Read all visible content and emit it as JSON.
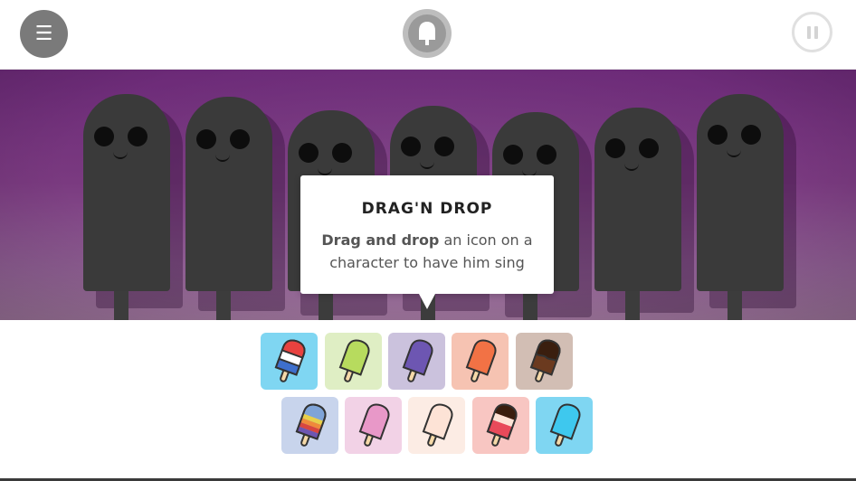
{
  "topbar": {
    "menu_icon": "☰",
    "logo_icon": "popsicle-logo-icon",
    "pause_icon": "pause-icon"
  },
  "stage": {
    "background_color": "#7a3a80",
    "character_color": "#3a3a3a",
    "character_count": 7
  },
  "tooltip": {
    "title": "DRAG'N DROP",
    "body_bold": "Drag and drop",
    "body_rest": " an icon on a character to have him sing"
  },
  "palette": {
    "row1": [
      {
        "name": "rocket-pop",
        "tile_color": "#7fd6f2"
      },
      {
        "name": "lime",
        "tile_color": "#dfeec4"
      },
      {
        "name": "grape",
        "tile_color": "#cbc2dd"
      },
      {
        "name": "orange",
        "tile_color": "#f6c3b2"
      },
      {
        "name": "chocolate",
        "tile_color": "#d2beb4"
      }
    ],
    "row2": [
      {
        "name": "rainbow",
        "tile_color": "#c8d4ec"
      },
      {
        "name": "pink",
        "tile_color": "#f2d2e6"
      },
      {
        "name": "vanilla",
        "tile_color": "#fcece4"
      },
      {
        "name": "neapolitan",
        "tile_color": "#f8c6c2"
      },
      {
        "name": "blue",
        "tile_color": "#7fd6f2"
      }
    ]
  }
}
